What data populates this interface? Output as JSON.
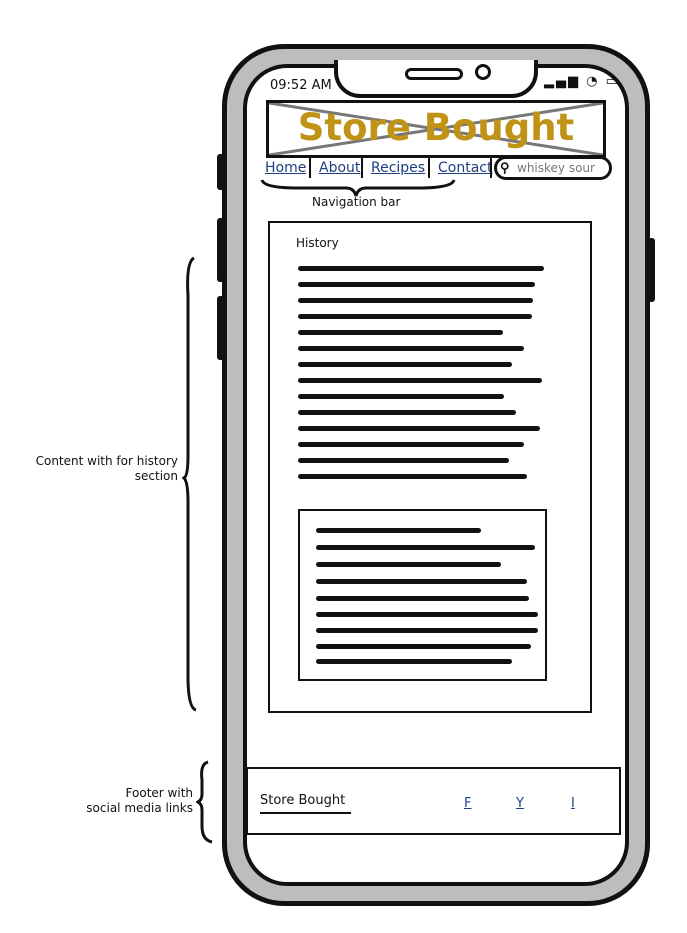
{
  "status_bar": {
    "time": "09:52 AM",
    "signal_icon": "signal-icon",
    "wifi_icon": "wifi-icon",
    "battery_icon": "battery-icon"
  },
  "header": {
    "logo_text": "Store Bought",
    "logo_color": "#c09317"
  },
  "nav": {
    "items": [
      {
        "label": "Home"
      },
      {
        "label": "About"
      },
      {
        "label": "Recipes"
      },
      {
        "label": "Contact"
      }
    ],
    "link_color": "#1d3f82"
  },
  "search": {
    "placeholder": "whiskey sour",
    "icon": "search-icon"
  },
  "annotations": {
    "nav": "Navigation bar",
    "content": "Content with for history\nsection",
    "footer": "Footer with\nsocial media links"
  },
  "content": {
    "title": "History"
  },
  "footer": {
    "brand": "Store Bought",
    "social_links": [
      {
        "label": "F"
      },
      {
        "label": "Y"
      },
      {
        "label": "I"
      }
    ]
  }
}
